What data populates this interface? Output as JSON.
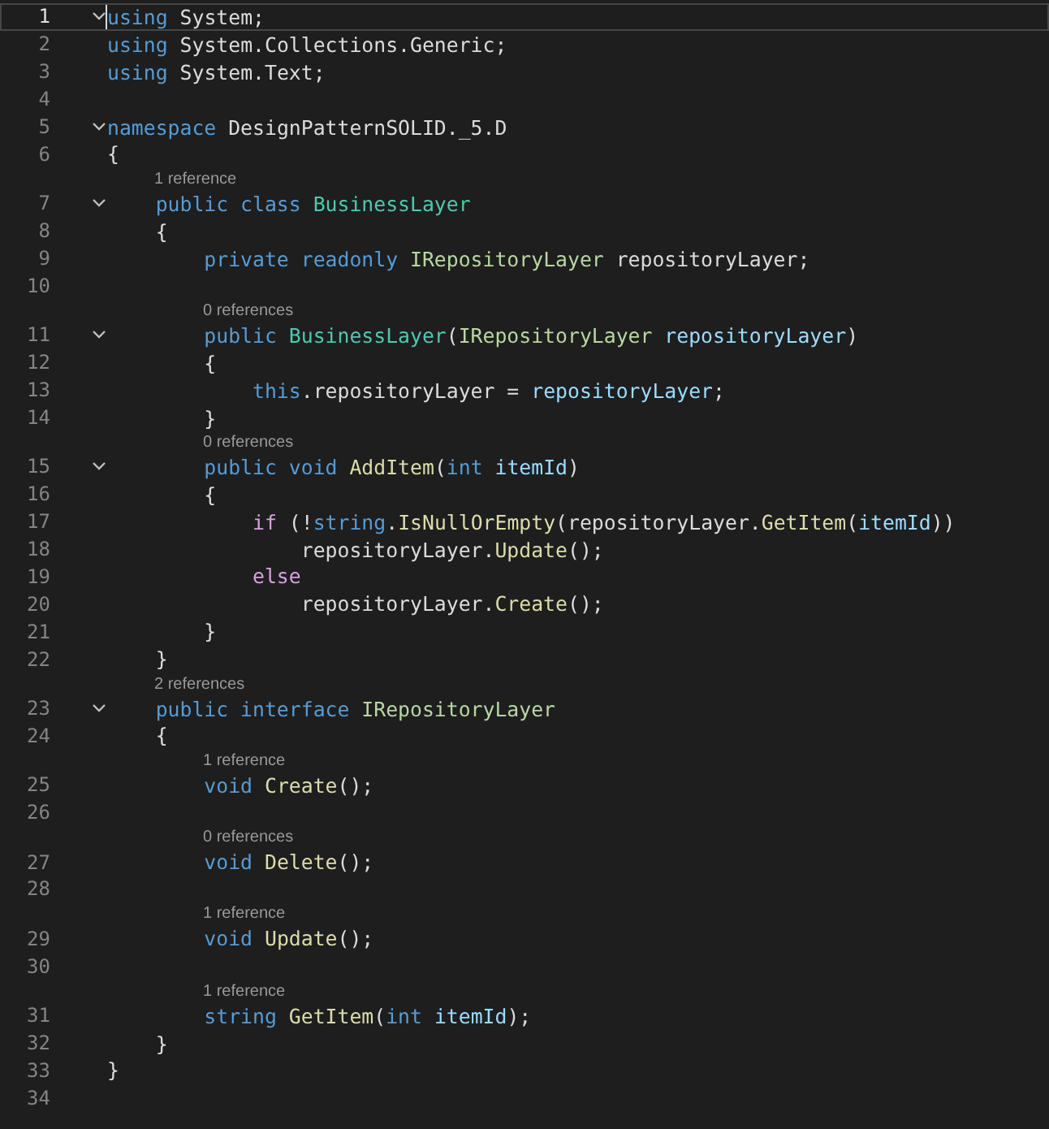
{
  "editor": {
    "lines": [
      {
        "number": "1",
        "selected": true,
        "expanded": true,
        "tokens": [
          {
            "text": "using",
            "kind": "keyword"
          },
          {
            "text": " System;",
            "kind": "plain"
          }
        ]
      },
      {
        "number": "2",
        "selected": false,
        "tokens": [
          {
            "text": "using",
            "kind": "keyword"
          },
          {
            "text": " System.Collections.Generic;",
            "kind": "plain"
          }
        ]
      },
      {
        "number": "3",
        "selected": false,
        "tokens": [
          {
            "text": "using",
            "kind": "keyword"
          },
          {
            "text": " System.Text;",
            "kind": "plain"
          }
        ]
      },
      {
        "number": "4",
        "selected": false
      },
      {
        "number": "5",
        "selected": false,
        "expanded": true,
        "tokens": [
          {
            "text": "namespace",
            "kind": "keyword"
          },
          {
            "text": " DesignPatternSOLID._5.D",
            "kind": "plain"
          }
        ]
      },
      {
        "number": "6",
        "selected": false,
        "tokens": [
          {
            "text": "{",
            "kind": "plain"
          }
        ]
      },
      {
        "number": "7",
        "selected": false,
        "expanded": true,
        "lens": "1 reference",
        "tokens": [
          {
            "text": "    public class",
            "kind": "keyword"
          },
          {
            "text": " BusinessLayer",
            "kind": "type"
          }
        ]
      },
      {
        "number": "8",
        "selected": false,
        "tokens": [
          {
            "text": "    {",
            "kind": "plain"
          }
        ]
      },
      {
        "number": "9",
        "selected": false,
        "tokens": [
          {
            "text": "        private readonly",
            "kind": "keyword"
          },
          {
            "text": " IRepositoryLayer",
            "kind": "interface"
          },
          {
            "text": " repositoryLayer;",
            "kind": "plain"
          }
        ]
      },
      {
        "number": "10",
        "selected": false
      },
      {
        "number": "11",
        "selected": false,
        "expanded": true,
        "lens": "0 references",
        "tokens": [
          {
            "text": "        public",
            "kind": "keyword"
          },
          {
            "text": " BusinessLayer",
            "kind": "type"
          },
          {
            "text": "(",
            "kind": "plain"
          },
          {
            "text": "IRepositoryLayer",
            "kind": "interface"
          },
          {
            "text": " repositoryLayer",
            "kind": "param"
          },
          {
            "text": ")",
            "kind": "plain"
          }
        ]
      },
      {
        "number": "12",
        "selected": false,
        "tokens": [
          {
            "text": "        {",
            "kind": "plain"
          }
        ]
      },
      {
        "number": "13",
        "selected": false,
        "tokens": [
          {
            "text": "            this",
            "kind": "keyword"
          },
          {
            "text": ".repositoryLayer = ",
            "kind": "plain"
          },
          {
            "text": "repositoryLayer",
            "kind": "param"
          },
          {
            "text": ";",
            "kind": "plain"
          }
        ]
      },
      {
        "number": "14",
        "selected": false,
        "tokens": [
          {
            "text": "        }",
            "kind": "plain"
          }
        ]
      },
      {
        "number": "15",
        "selected": false,
        "expanded": true,
        "lens": "0 references",
        "tokens": [
          {
            "text": "        public void",
            "kind": "keyword"
          },
          {
            "text": " AddItem",
            "kind": "method"
          },
          {
            "text": "(",
            "kind": "plain"
          },
          {
            "text": "int",
            "kind": "keyword"
          },
          {
            "text": " itemId",
            "kind": "param"
          },
          {
            "text": ")",
            "kind": "plain"
          }
        ]
      },
      {
        "number": "16",
        "selected": false,
        "tokens": [
          {
            "text": "        {",
            "kind": "plain"
          }
        ]
      },
      {
        "number": "17",
        "selected": false,
        "tokens": [
          {
            "text": "            if",
            "kind": "control"
          },
          {
            "text": " (!",
            "kind": "plain"
          },
          {
            "text": "string",
            "kind": "keyword"
          },
          {
            "text": ".",
            "kind": "plain"
          },
          {
            "text": "IsNullOrEmpty",
            "kind": "method"
          },
          {
            "text": "(repositoryLayer.",
            "kind": "plain"
          },
          {
            "text": "GetItem",
            "kind": "method"
          },
          {
            "text": "(",
            "kind": "plain"
          },
          {
            "text": "itemId",
            "kind": "param"
          },
          {
            "text": "))",
            "kind": "plain"
          }
        ]
      },
      {
        "number": "18",
        "selected": false,
        "tokens": [
          {
            "text": "                repositoryLayer.",
            "kind": "plain"
          },
          {
            "text": "Update",
            "kind": "method"
          },
          {
            "text": "();",
            "kind": "plain"
          }
        ]
      },
      {
        "number": "19",
        "selected": false,
        "tokens": [
          {
            "text": "            else",
            "kind": "control"
          }
        ]
      },
      {
        "number": "20",
        "selected": false,
        "tokens": [
          {
            "text": "                repositoryLayer.",
            "kind": "plain"
          },
          {
            "text": "Create",
            "kind": "method"
          },
          {
            "text": "();",
            "kind": "plain"
          }
        ]
      },
      {
        "number": "21",
        "selected": false,
        "tokens": [
          {
            "text": "        }",
            "kind": "plain"
          }
        ]
      },
      {
        "number": "22",
        "selected": false,
        "tokens": [
          {
            "text": "    }",
            "kind": "plain"
          }
        ]
      },
      {
        "number": "23",
        "selected": false,
        "expanded": true,
        "lens": "2 references",
        "tokens": [
          {
            "text": "    public interface",
            "kind": "keyword"
          },
          {
            "text": " IRepositoryLayer",
            "kind": "interface"
          }
        ]
      },
      {
        "number": "24",
        "selected": false,
        "tokens": [
          {
            "text": "    {",
            "kind": "plain"
          }
        ]
      },
      {
        "number": "25",
        "selected": false,
        "lens": "1 reference",
        "tokens": [
          {
            "text": "        void",
            "kind": "keyword"
          },
          {
            "text": " Create",
            "kind": "method"
          },
          {
            "text": "();",
            "kind": "plain"
          }
        ]
      },
      {
        "number": "26",
        "selected": false
      },
      {
        "number": "27",
        "selected": false,
        "lens": "0 references",
        "tokens": [
          {
            "text": "        void",
            "kind": "keyword"
          },
          {
            "text": " Delete",
            "kind": "method"
          },
          {
            "text": "();",
            "kind": "plain"
          }
        ]
      },
      {
        "number": "28",
        "selected": false
      },
      {
        "number": "29",
        "selected": false,
        "lens": "1 reference",
        "tokens": [
          {
            "text": "        void",
            "kind": "keyword"
          },
          {
            "text": " Update",
            "kind": "method"
          },
          {
            "text": "();",
            "kind": "plain"
          }
        ]
      },
      {
        "number": "30",
        "selected": false
      },
      {
        "number": "31",
        "selected": false,
        "lens": "1 reference",
        "tokens": [
          {
            "text": "        string",
            "kind": "keyword"
          },
          {
            "text": " GetItem",
            "kind": "method"
          },
          {
            "text": "(",
            "kind": "plain"
          },
          {
            "text": "int",
            "kind": "keyword"
          },
          {
            "text": " itemId",
            "kind": "param"
          },
          {
            "text": ");",
            "kind": "plain"
          }
        ]
      },
      {
        "number": "32",
        "selected": false,
        "tokens": [
          {
            "text": "    }",
            "kind": "plain"
          }
        ]
      },
      {
        "number": "33",
        "selected": false,
        "tokens": [
          {
            "text": "}",
            "kind": "plain"
          }
        ]
      },
      {
        "number": "34",
        "selected": false
      }
    ]
  }
}
